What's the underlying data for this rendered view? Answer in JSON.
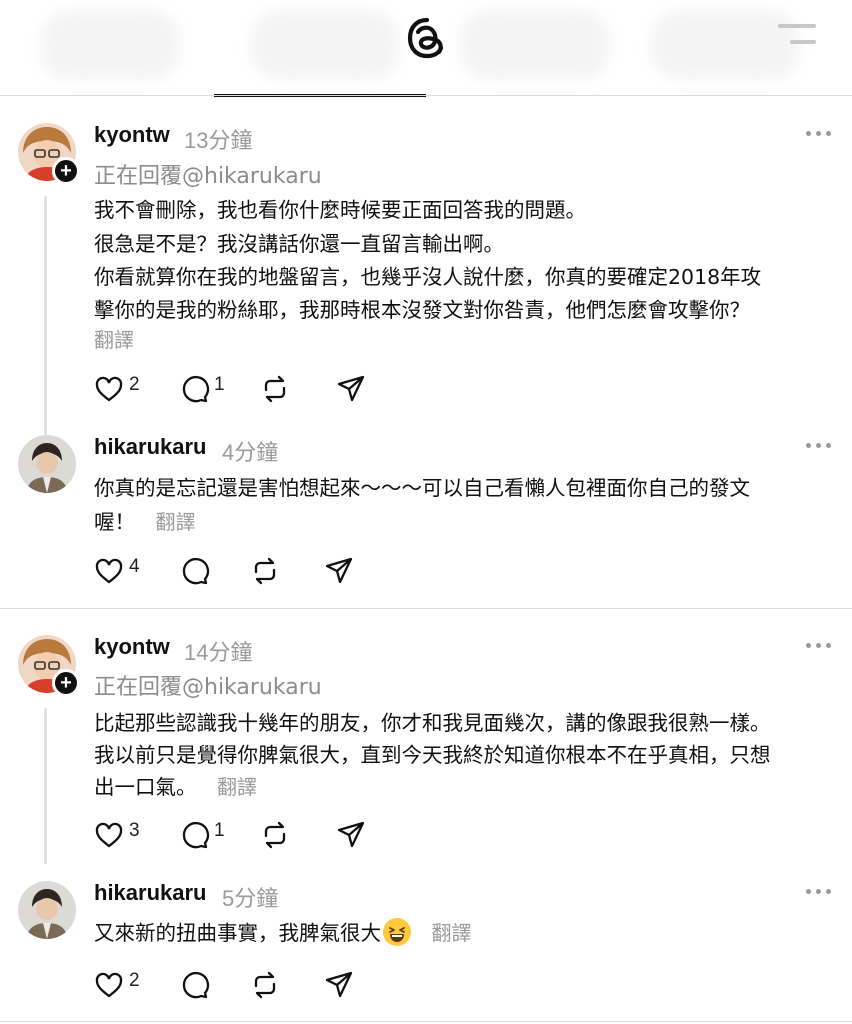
{
  "posts": [
    {
      "username": "kyontw",
      "time": "13分鐘",
      "reply_to": "正在回覆@hikarukaru",
      "lines": [
        "我不會刪除，我也看你什麼時候要正面回答我的問題。",
        "很急是不是？我沒講話你還一直留言輸出啊。",
        "你看就算你在我的地盤留言，也幾乎沒人說什麼，你真的要確定2018年攻",
        "擊你的是我的粉絲耶，我那時根本沒發文對你咎責，他們怎麼會攻擊你？"
      ],
      "translate": "翻譯",
      "likes": "2",
      "replies": "1"
    },
    {
      "username": "hikarukaru",
      "time": "4分鐘",
      "lines": [
        "你真的是忘記還是害怕想起來～～～可以自己看懶人包裡面你自己的發文",
        "喔！"
      ],
      "translate": "翻譯",
      "likes": "4"
    },
    {
      "username": "kyontw",
      "time": "14分鐘",
      "reply_to": "正在回覆@hikarukaru",
      "lines": [
        "比起那些認識我十幾年的朋友，你才和我見面幾次，講的像跟我很熟一樣。",
        "我以前只是覺得你脾氣很大，直到今天我終於知道你根本不在乎真相，只想",
        "出一口氣。"
      ],
      "translate": "翻譯",
      "likes": "3",
      "replies": "1"
    },
    {
      "username": "hikarukaru",
      "time": "5分鐘",
      "lines": [
        "又來新的扭曲事實，我脾氣很大"
      ],
      "emoji": "grinning-squinting-face-icon",
      "translate": "翻譯",
      "likes": "2"
    }
  ],
  "colors": {
    "text": "#111111",
    "muted": "#9a9a9a",
    "divider": "#dcdcdc",
    "badge": "#111111"
  }
}
